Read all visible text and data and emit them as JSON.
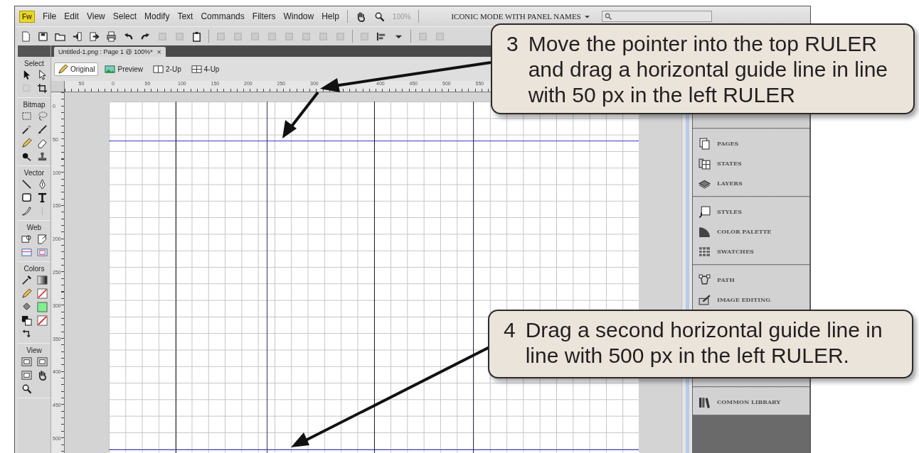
{
  "app_logo": "Fw",
  "menu": [
    "File",
    "Edit",
    "View",
    "Select",
    "Modify",
    "Text",
    "Commands",
    "Filters",
    "Window",
    "Help"
  ],
  "zoom_level": "100%",
  "workspace": "ICONIC MODE WITH PANEL NAMES",
  "document_tab": {
    "title": "Untitled-1.png : Page 1 @ 100%*",
    "close": "×"
  },
  "view_tabs": [
    {
      "label": "Original",
      "selected": true
    },
    {
      "label": "Preview",
      "selected": false
    },
    {
      "label": "2-Up",
      "selected": false
    },
    {
      "label": "4-Up",
      "selected": false
    }
  ],
  "tool_groups": [
    "Select",
    "Bitmap",
    "Vector",
    "Web",
    "Colors",
    "View"
  ],
  "top_ruler": [
    "50",
    "0",
    "50",
    "100",
    "150",
    "200",
    "250",
    "300",
    "400",
    "450",
    "500",
    "550"
  ],
  "left_ruler": [
    "0",
    "50",
    "100",
    "150",
    "200",
    "250",
    "300",
    "350",
    "400",
    "450",
    "500"
  ],
  "panel_groups": [
    {
      "items": [
        "PAGES",
        "STATES",
        "LAYERS"
      ]
    },
    {
      "items": [
        "STYLES",
        "COLOR PALETTE",
        "SWATCHES"
      ]
    },
    {
      "items": [
        "PATH",
        "IMAGE EDITING"
      ]
    },
    {
      "items": [
        "COMMON LIBRARY"
      ]
    }
  ],
  "callouts": [
    {
      "number": "3",
      "text": "Move the pointer into the top RULER and drag a horizontal guide line in line with 50 px in the left RULER"
    },
    {
      "number": "4",
      "text": "Drag a second horizontal guide line in line with 500 px in the left RULER."
    }
  ]
}
